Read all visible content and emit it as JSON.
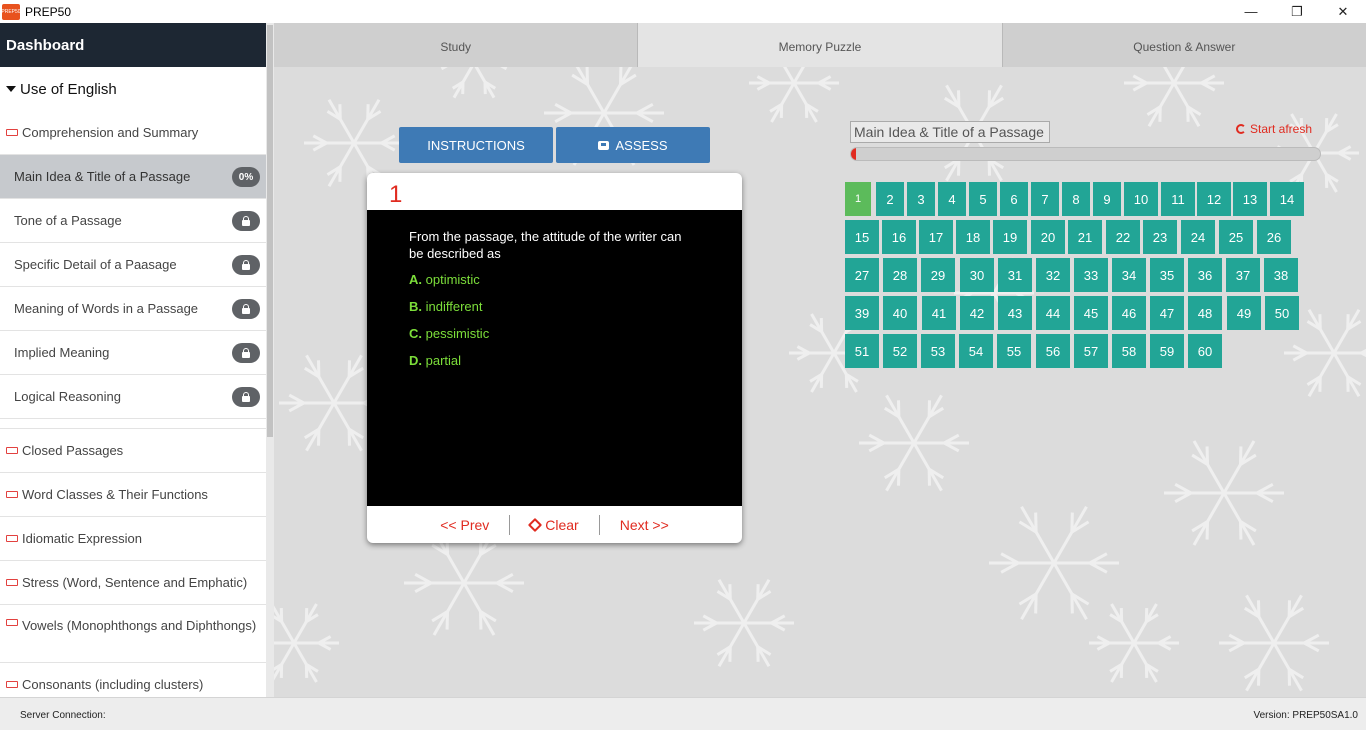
{
  "app": {
    "title": "PREP50",
    "icon_label": "PREP50"
  },
  "window": {
    "minimize": "—",
    "restore": "❐",
    "close": "✕"
  },
  "sidebar": {
    "dashboard": "Dashboard",
    "section": "Use of English",
    "topic_first": "Comprehension and Summary",
    "subtopics": [
      {
        "label": "Main Idea & Title of a Passage",
        "badge": "0%",
        "active": true
      },
      {
        "label": "Tone of a Passage",
        "locked": true
      },
      {
        "label": "Specific Detail of a Paasage",
        "locked": true
      },
      {
        "label": "Meaning of Words in a Passage",
        "locked": true
      },
      {
        "label": "Implied Meaning",
        "locked": true
      },
      {
        "label": "Logical Reasoning",
        "locked": true
      }
    ],
    "topics": [
      "Closed Passages",
      "Word Classes & Their Functions",
      "Idiomatic Expression",
      "Stress (Word, Sentence and Emphatic)",
      "Vowels (Monophthongs and Diphthongs)",
      "Consonants (including clusters)"
    ]
  },
  "tabs": [
    "Study",
    "Memory Puzzle",
    "Question & Answer"
  ],
  "active_tab": "Memory Puzzle",
  "buttons": {
    "instructions": "INSTRUCTIONS",
    "assess": "ASSESS"
  },
  "question": {
    "number": "1",
    "text": "From the passage, the attitude of the writer can be described as",
    "options": [
      {
        "letter": "A.",
        "text": "optimistic"
      },
      {
        "letter": "B.",
        "text": "indifferent"
      },
      {
        "letter": "C.",
        "text": "pessimistic"
      },
      {
        "letter": "D.",
        "text": "partial"
      }
    ]
  },
  "nav": {
    "prev": "<< Prev",
    "clear": "Clear",
    "next": "Next >>"
  },
  "puzzle": {
    "title": "Main Idea & Title of a Passage",
    "start_afresh": "Start afresh",
    "progress_fraction": 0.01,
    "total": 60,
    "current": 1
  },
  "colors": {
    "accent": "#22a596",
    "current": "#5cbb5b",
    "button": "#3e7ab5",
    "red": "#e02b20",
    "dark": "#1d2733"
  },
  "status": {
    "server": "Server Connection:",
    "version": "Version: PREP50SA1.0"
  }
}
